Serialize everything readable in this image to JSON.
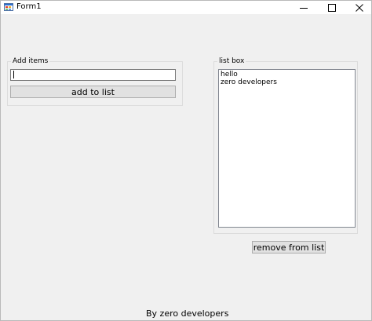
{
  "window": {
    "title": "Form1",
    "icon": "winforms-app-icon"
  },
  "controls": {
    "minimize_icon": "minimize-icon",
    "maximize_icon": "maximize-icon",
    "close_icon": "close-icon"
  },
  "add_group": {
    "label": "Add items",
    "input_value": "",
    "button_label": "add to list"
  },
  "list_group": {
    "label": "list box",
    "items": [
      "hello",
      "zero developers"
    ]
  },
  "remove_button_label": "remove from list",
  "footer": {
    "text": "By zero developers"
  },
  "colors": {
    "form_background": "#f0f0f0",
    "titlebar_background": "#ffffff",
    "button_background": "#e1e1e1",
    "button_border": "#adadad"
  }
}
